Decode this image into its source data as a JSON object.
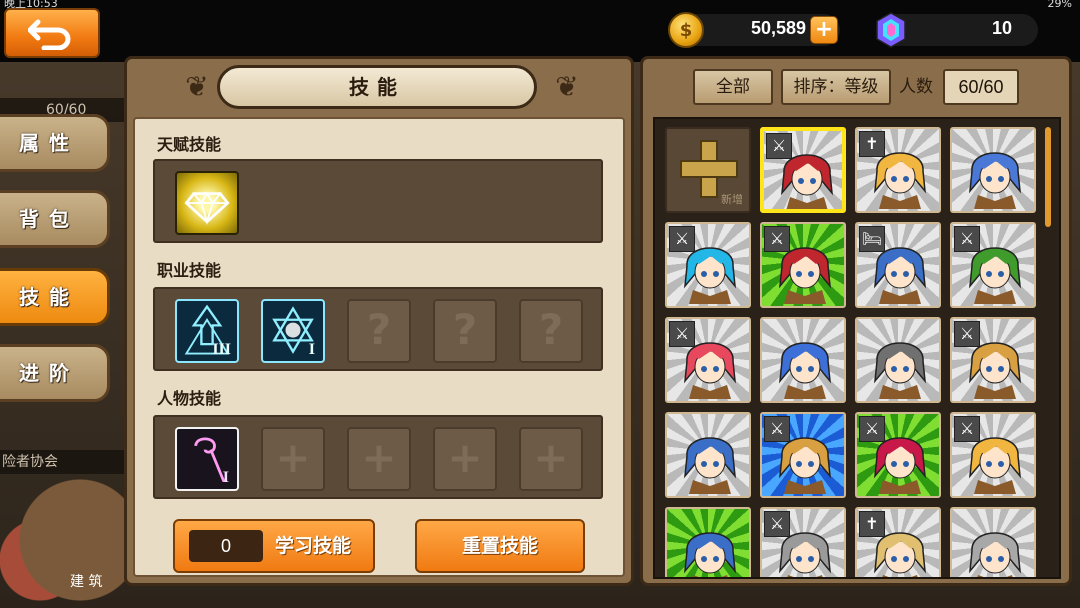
{
  "status": {
    "time": "晚上10:53",
    "battery": "29%"
  },
  "currency": {
    "gold": "50,589",
    "gold_plus": "+",
    "gems": "10"
  },
  "side_tabs": [
    {
      "label": "属性",
      "active": false
    },
    {
      "label": "背包",
      "active": false
    },
    {
      "label": "技能",
      "active": true
    },
    {
      "label": "进阶",
      "active": false
    }
  ],
  "side_under": {
    "level": "60/60",
    "guild": "险者协会",
    "building": "建 筑"
  },
  "skill_panel": {
    "title": "技能",
    "talent_label": "天赋技能",
    "class_label": "职业技能",
    "character_label": "人物技能",
    "class_skill_tiers": [
      "III",
      "I"
    ],
    "character_skill_tier": "I",
    "locked_glyph": "?",
    "empty_glyph": "+",
    "learn_count": "0",
    "learn_label": "学习技能",
    "reset_label": "重置技能"
  },
  "hero_panel": {
    "filter_all": "全部",
    "sort_label": "排序：等级",
    "count_label": "人数",
    "count_value": "60/60",
    "add_label": "新增"
  },
  "heroes": [
    {
      "bg": "add",
      "hair": "",
      "badge": ""
    },
    {
      "bg": "gray",
      "hair": "#c0262e",
      "badge": "sword",
      "selected": true
    },
    {
      "bg": "gray",
      "hair": "#f0b640",
      "badge": "cross"
    },
    {
      "bg": "gray",
      "hair": "#4a78d6",
      "badge": ""
    },
    {
      "bg": "gray",
      "hair": "#22b7e6",
      "badge": "sword"
    },
    {
      "bg": "green",
      "hair": "#c0262e",
      "badge": "sword"
    },
    {
      "bg": "gray",
      "hair": "#3a6ec7",
      "badge": "bed"
    },
    {
      "bg": "gray",
      "hair": "#3f9c2c",
      "badge": "sword"
    },
    {
      "bg": "gray",
      "hair": "#e8485e",
      "badge": "sword"
    },
    {
      "bg": "gray",
      "hair": "#3c70d8",
      "badge": ""
    },
    {
      "bg": "gray",
      "hair": "#707070",
      "badge": ""
    },
    {
      "bg": "gray",
      "hair": "#d8a040",
      "badge": "sword"
    },
    {
      "bg": "gray",
      "hair": "#3a6ec7",
      "badge": ""
    },
    {
      "bg": "blue",
      "hair": "#d8a040",
      "badge": "sword"
    },
    {
      "bg": "green",
      "hair": "#c8184a",
      "badge": "sword"
    },
    {
      "bg": "gray",
      "hair": "#f0b640",
      "badge": "sword"
    },
    {
      "bg": "green",
      "hair": "#3a6ec7",
      "badge": ""
    },
    {
      "bg": "gray",
      "hair": "#9a9a9a",
      "badge": "sword"
    },
    {
      "bg": "gray",
      "hair": "#e0c070",
      "badge": "cross"
    },
    {
      "bg": "gray",
      "hair": "#a8a8a8",
      "badge": ""
    }
  ]
}
